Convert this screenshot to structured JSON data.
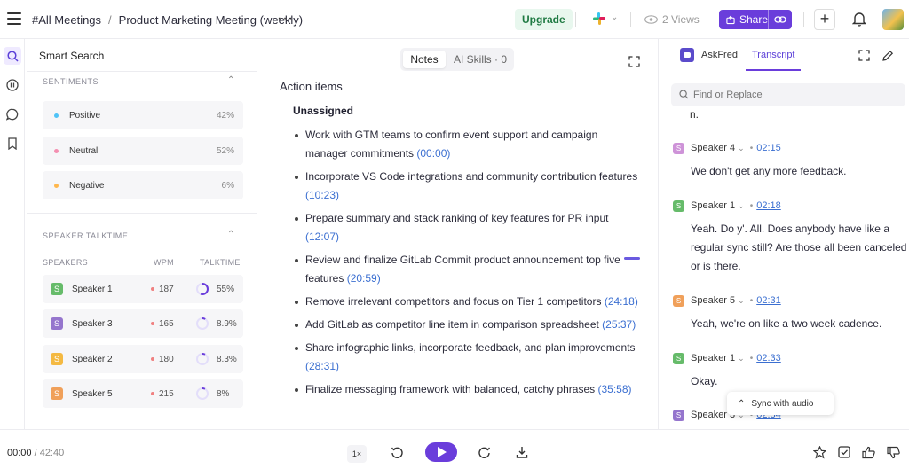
{
  "header": {
    "breadcrumb_parent": "#All Meetings",
    "breadcrumb_sep": "/",
    "meeting_title": "Product Marketing Meeting (weekly)",
    "more": "···",
    "upgrade_label": "Upgrade",
    "views_label": "2 Views",
    "share_label": "Share",
    "add_label": "+"
  },
  "rail": {
    "icons": [
      "search-icon",
      "pause-icon",
      "chat-icon",
      "bookmark-icon"
    ]
  },
  "left_panel": {
    "title": "Smart Search",
    "sentiments": {
      "title": "SENTIMENTS",
      "rows": [
        {
          "label": "Positive",
          "pct": "42%",
          "color": "#4fc3f7"
        },
        {
          "label": "Neutral",
          "pct": "52%",
          "color": "#f48fb1"
        },
        {
          "label": "Negative",
          "pct": "6%",
          "color": "#ffb74d"
        }
      ]
    },
    "talktime": {
      "title": "SPEAKER TALKTIME",
      "col_speakers": "SPEAKERS",
      "col_wpm": "WPM",
      "col_talktime": "TALKTIME",
      "rows": [
        {
          "badge": "S",
          "name": "Speaker 1",
          "wpm": "187",
          "talktime": "55%",
          "fraction": 0.55,
          "color": "#66bb6a"
        },
        {
          "badge": "S",
          "name": "Speaker 3",
          "wpm": "165",
          "talktime": "8.9%",
          "fraction": 0.089,
          "color": "#9575cd"
        },
        {
          "badge": "S",
          "name": "Speaker 2",
          "wpm": "180",
          "talktime": "8.3%",
          "fraction": 0.083,
          "color": "#f4b942"
        },
        {
          "badge": "S",
          "name": "Speaker 5",
          "wpm": "215",
          "talktime": "8%",
          "fraction": 0.08,
          "color": "#f0a05a"
        }
      ]
    }
  },
  "center": {
    "tab_notes": "Notes",
    "tab_ai_skills": "AI Skills · 0",
    "section_title": "Action items",
    "group_title": "Unassigned",
    "items": [
      {
        "text": "Work with GTM teams to confirm event support and campaign manager commitments ",
        "ts": "(00:00)"
      },
      {
        "text": "Incorporate VS Code integrations and community contribution features ",
        "ts": "(10:23)"
      },
      {
        "text": "Prepare summary and stack ranking of key features for PR input ",
        "ts": "(12:07)"
      },
      {
        "text": "Review and finalize GitLab Commit product announcement top five features ",
        "ts": "(20:59)"
      },
      {
        "text": "Remove irrelevant competitors and focus on Tier 1 competitors ",
        "ts": "(24:18)"
      },
      {
        "text": "Add GitLab as competitor line item in comparison spreadsheet ",
        "ts": "(25:37)"
      },
      {
        "text": "Share infographic links, incorporate feedback, and plan improvements ",
        "ts": "(28:31)"
      },
      {
        "text": "Finalize messaging framework with balanced, catchy phrases ",
        "ts": "(35:58)"
      }
    ]
  },
  "right_panel": {
    "tab_askfred": "AskFred",
    "tab_transcript": "Transcript",
    "find_placeholder": "Find or Replace",
    "fragment": "n.",
    "entries": [
      {
        "badge": "S",
        "speaker": "Speaker 4",
        "time": "02:15",
        "text": "We don't get any more feedback.",
        "color": "#ce93d8"
      },
      {
        "badge": "S",
        "speaker": "Speaker 1",
        "time": "02:18",
        "text": "Yeah. Do y'. All. Does anybody have like a regular sync still? Are those all been canceled or is there.",
        "color": "#66bb6a"
      },
      {
        "badge": "S",
        "speaker": "Speaker 5",
        "time": "02:31",
        "text": "Yeah, we're on like a two week cadence.",
        "color": "#f0a05a"
      },
      {
        "badge": "S",
        "speaker": "Speaker 1",
        "time": "02:33",
        "text": "Okay.",
        "color": "#66bb6a"
      },
      {
        "badge": "S",
        "speaker": "Speaker 3",
        "time": "02:34",
        "text": "",
        "color": "#9575cd"
      }
    ],
    "sync_label": "Sync with audio"
  },
  "player": {
    "current": "00:00",
    "duration": " / 42:40",
    "speed": "1×"
  },
  "colors": {
    "accent": "#6a3ddb",
    "link": "#3b6fd1",
    "upgrade_bg": "#e8f7ee"
  }
}
